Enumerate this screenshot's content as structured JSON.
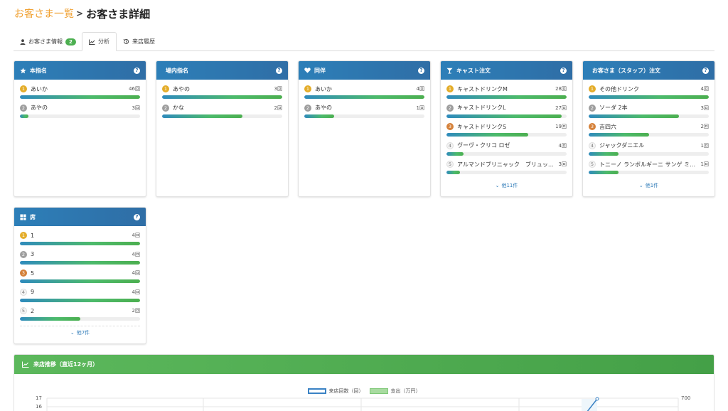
{
  "breadcrumb": {
    "parent": "お客さま一覧",
    "separator": ">",
    "current": "お客さま詳細"
  },
  "tabs": [
    {
      "label": "お客さま情報",
      "badge": "2",
      "icon": "user-icon"
    },
    {
      "label": "分析",
      "icon": "line-chart-icon"
    },
    {
      "label": "来店履歴",
      "icon": "history-icon"
    }
  ],
  "cards": {
    "honshimei": {
      "title": "本指名",
      "icon": "star-icon",
      "items": [
        {
          "rank": "1",
          "name": "あいか",
          "count": "46回",
          "level": 1.0
        },
        {
          "rank": "2",
          "name": "あやの",
          "count": "3回",
          "level": 0.07
        }
      ]
    },
    "jonai": {
      "title": "場内指名",
      "icon": "none",
      "items": [
        {
          "rank": "1",
          "name": "あやの",
          "count": "3回",
          "level": 1.0
        },
        {
          "rank": "2",
          "name": "かな",
          "count": "2回",
          "level": 0.67
        }
      ]
    },
    "douhan": {
      "title": "同伴",
      "icon": "heart-icon",
      "items": [
        {
          "rank": "1",
          "name": "あいか",
          "count": "4回",
          "level": 1.0
        },
        {
          "rank": "2",
          "name": "あやの",
          "count": "1回",
          "level": 0.25
        }
      ]
    },
    "cast_order": {
      "title": "キャスト注文",
      "icon": "cocktail-icon",
      "items": [
        {
          "rank": "1",
          "name": "キャストドリンクM",
          "count": "28回",
          "level": 1.0
        },
        {
          "rank": "2",
          "name": "キャストドリンクL",
          "count": "27回",
          "level": 0.96
        },
        {
          "rank": "3",
          "name": "キャストドリンクS",
          "count": "19回",
          "level": 0.68
        },
        {
          "rank": "4",
          "name": "ヴーヴ・クリコ ロゼ",
          "count": "4回",
          "level": 0.14
        },
        {
          "rank": "5",
          "name": "アルマンドブリニャック　ブリュットゴールド",
          "count": "3回",
          "level": 0.11
        }
      ],
      "more": "他11件"
    },
    "guest_order": {
      "title": "お客さま（スタッフ）注文",
      "icon": "none",
      "items": [
        {
          "rank": "1",
          "name": "その他ドリンク",
          "count": "4回",
          "level": 1.0
        },
        {
          "rank": "2",
          "name": "ソーダ 2本",
          "count": "3回",
          "level": 0.75
        },
        {
          "rank": "3",
          "name": "吉四六",
          "count": "2回",
          "level": 0.5
        },
        {
          "rank": "4",
          "name": "ジャックダニエル",
          "count": "1回",
          "level": 0.25
        },
        {
          "rank": "5",
          "name": "トニーノ ランボルギーニ サンゲ ミウラ",
          "count": "1回",
          "level": 0.25
        }
      ],
      "more": "他1件"
    },
    "seat": {
      "title": "席",
      "icon": "table-grid-icon",
      "items": [
        {
          "rank": "1",
          "name": "1",
          "count": "4回",
          "level": 1.0
        },
        {
          "rank": "2",
          "name": "3",
          "count": "4回",
          "level": 1.0
        },
        {
          "rank": "3",
          "name": "5",
          "count": "4回",
          "level": 1.0
        },
        {
          "rank": "4",
          "name": "9",
          "count": "4回",
          "level": 1.0
        },
        {
          "rank": "5",
          "name": "2",
          "count": "2回",
          "level": 0.5
        }
      ],
      "more": "他7件"
    }
  },
  "trend": {
    "title": "来店推移（直近12ヶ月）",
    "icon": "area-chart-icon",
    "chart_data": {
      "type": "line",
      "series": [
        {
          "name": "来店回数（回）",
          "color": "#3a82c4"
        },
        {
          "name": "支出（万円）",
          "color": "#7fc877"
        }
      ],
      "y_left_ticks": [
        "17",
        "16"
      ],
      "y_right_ticks": [
        "700"
      ],
      "grid": true
    }
  },
  "colors": {
    "header_blue": "#2f6ea6",
    "header_green": "#4caf50",
    "accent_orange": "#f0a030",
    "link_blue": "#2f7bb8"
  }
}
